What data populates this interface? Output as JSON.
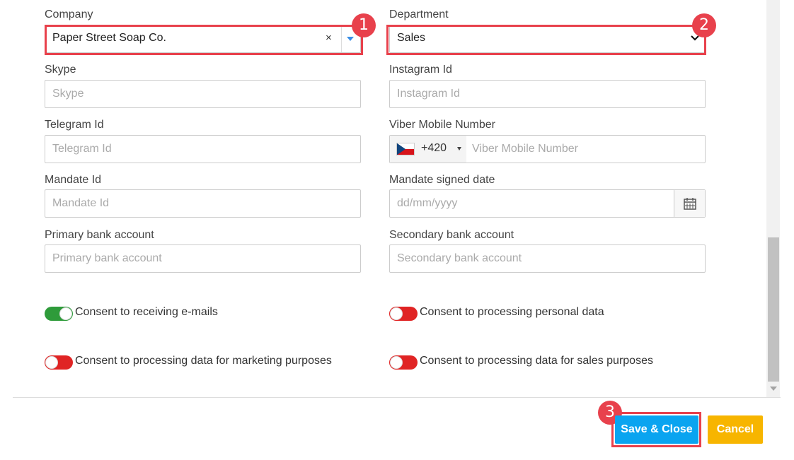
{
  "form": {
    "company": {
      "label": "Company",
      "value": "Paper Street Soap Co.",
      "clear": "×"
    },
    "department": {
      "label": "Department",
      "value": "Sales"
    },
    "skype": {
      "label": "Skype",
      "placeholder": "Skype"
    },
    "instagram": {
      "label": "Instagram Id",
      "placeholder": "Instagram Id"
    },
    "telegram": {
      "label": "Telegram Id",
      "placeholder": "Telegram Id"
    },
    "viber": {
      "label": "Viber Mobile Number",
      "country_code": "+420",
      "placeholder": "Viber Mobile Number"
    },
    "mandate_id": {
      "label": "Mandate Id",
      "placeholder": "Mandate Id"
    },
    "mandate_date": {
      "label": "Mandate signed date",
      "placeholder": "dd/mm/yyyy"
    },
    "primary_bank": {
      "label": "Primary bank account",
      "placeholder": "Primary bank account"
    },
    "secondary_bank": {
      "label": "Secondary bank account",
      "placeholder": "Secondary bank account"
    }
  },
  "consents": [
    {
      "label": "Consent to receiving e-mails",
      "state": "on"
    },
    {
      "label": "Consent to processing personal data",
      "state": "off"
    },
    {
      "label": "Consent to processing data for marketing purposes",
      "state": "off"
    },
    {
      "label": "Consent to processing data for sales purposes",
      "state": "off"
    }
  ],
  "annotations": {
    "one": "1",
    "two": "2",
    "three": "3"
  },
  "actions": {
    "save": "Save & Close",
    "cancel": "Cancel"
  },
  "colors": {
    "highlight": "#e8414c",
    "save": "#0aa4f0",
    "cancel": "#f7b500",
    "toggle_on": "#2e9b3a",
    "toggle_off": "#e02424"
  }
}
